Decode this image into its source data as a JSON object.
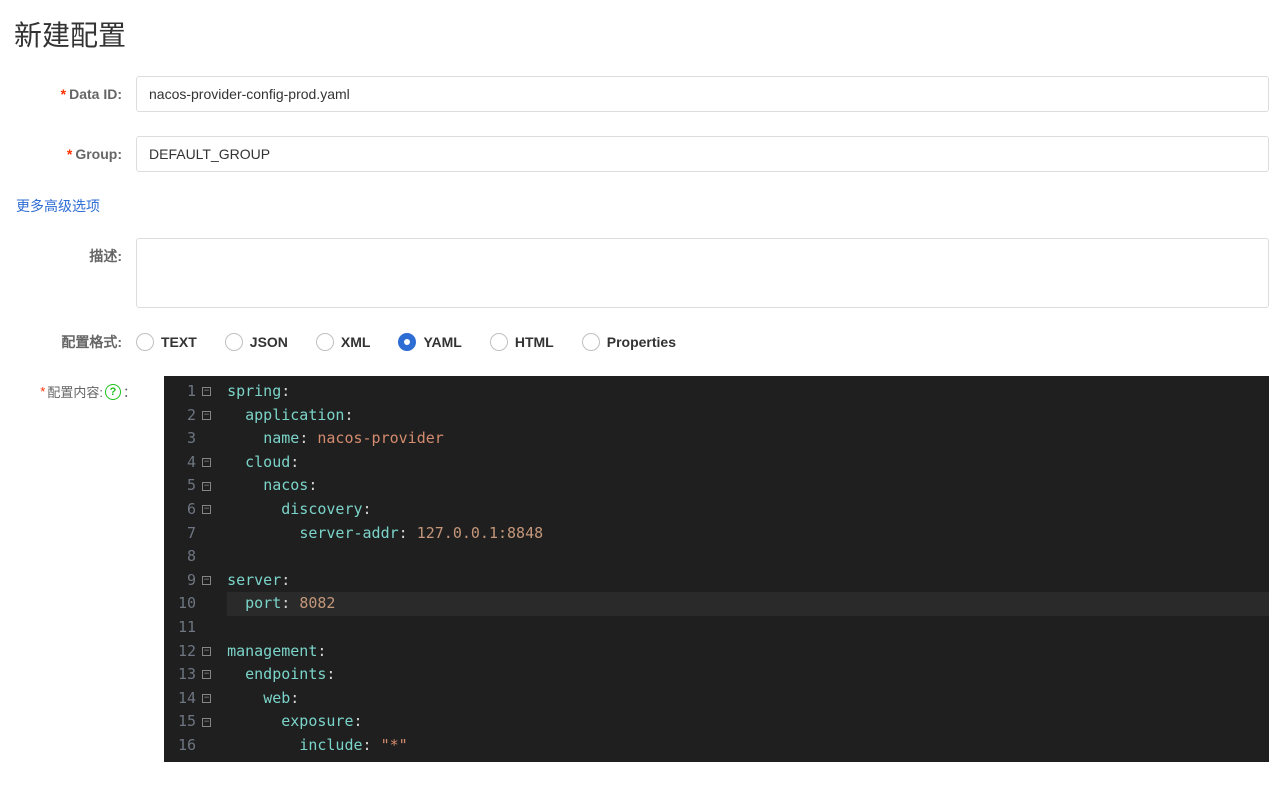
{
  "title": "新建配置",
  "labels": {
    "dataId": "Data ID:",
    "group": "Group:",
    "desc": "描述:",
    "format": "配置格式:",
    "content": "配置内容:"
  },
  "values": {
    "dataId": "nacos-provider-config-prod.yaml",
    "group": "DEFAULT_GROUP",
    "desc": ""
  },
  "advLink": "更多高级选项",
  "formatOptions": [
    "TEXT",
    "JSON",
    "XML",
    "YAML",
    "HTML",
    "Properties"
  ],
  "formatSelected": "YAML",
  "editor": {
    "lines": [
      {
        "num": 1,
        "fold": true,
        "tokens": [
          {
            "t": "spring",
            "c": "k-key"
          },
          {
            "t": ":",
            "c": "k-punc"
          }
        ]
      },
      {
        "num": 2,
        "fold": true,
        "tokens": [
          {
            "t": "  ",
            "c": ""
          },
          {
            "t": "application",
            "c": "k-key"
          },
          {
            "t": ":",
            "c": "k-punc"
          }
        ]
      },
      {
        "num": 3,
        "fold": false,
        "tokens": [
          {
            "t": "    ",
            "c": ""
          },
          {
            "t": "name",
            "c": "k-key"
          },
          {
            "t": ": ",
            "c": "k-punc"
          },
          {
            "t": "nacos-provider",
            "c": "k-str"
          }
        ]
      },
      {
        "num": 4,
        "fold": true,
        "tokens": [
          {
            "t": "  ",
            "c": ""
          },
          {
            "t": "cloud",
            "c": "k-key"
          },
          {
            "t": ":",
            "c": "k-punc"
          }
        ]
      },
      {
        "num": 5,
        "fold": true,
        "tokens": [
          {
            "t": "    ",
            "c": ""
          },
          {
            "t": "nacos",
            "c": "k-key"
          },
          {
            "t": ":",
            "c": "k-punc"
          }
        ]
      },
      {
        "num": 6,
        "fold": true,
        "tokens": [
          {
            "t": "      ",
            "c": ""
          },
          {
            "t": "discovery",
            "c": "k-key"
          },
          {
            "t": ":",
            "c": "k-punc"
          }
        ]
      },
      {
        "num": 7,
        "fold": false,
        "tokens": [
          {
            "t": "        ",
            "c": ""
          },
          {
            "t": "server-addr",
            "c": "k-key"
          },
          {
            "t": ": ",
            "c": "k-punc"
          },
          {
            "t": "127.0.0.1:8848",
            "c": "k-num"
          }
        ]
      },
      {
        "num": 8,
        "fold": false,
        "tokens": []
      },
      {
        "num": 9,
        "fold": true,
        "tokens": [
          {
            "t": "server",
            "c": "k-key"
          },
          {
            "t": ":",
            "c": "k-punc"
          }
        ]
      },
      {
        "num": 10,
        "fold": false,
        "hl": true,
        "tokens": [
          {
            "t": "  ",
            "c": ""
          },
          {
            "t": "port",
            "c": "k-key"
          },
          {
            "t": ": ",
            "c": "k-punc"
          },
          {
            "t": "8082",
            "c": "k-num"
          }
        ]
      },
      {
        "num": 11,
        "fold": false,
        "tokens": []
      },
      {
        "num": 12,
        "fold": true,
        "tokens": [
          {
            "t": "management",
            "c": "k-key"
          },
          {
            "t": ":",
            "c": "k-punc"
          }
        ]
      },
      {
        "num": 13,
        "fold": true,
        "tokens": [
          {
            "t": "  ",
            "c": ""
          },
          {
            "t": "endpoints",
            "c": "k-key"
          },
          {
            "t": ":",
            "c": "k-punc"
          }
        ]
      },
      {
        "num": 14,
        "fold": true,
        "tokens": [
          {
            "t": "    ",
            "c": ""
          },
          {
            "t": "web",
            "c": "k-key"
          },
          {
            "t": ":",
            "c": "k-punc"
          }
        ]
      },
      {
        "num": 15,
        "fold": true,
        "tokens": [
          {
            "t": "      ",
            "c": ""
          },
          {
            "t": "exposure",
            "c": "k-key"
          },
          {
            "t": ":",
            "c": "k-punc"
          }
        ]
      },
      {
        "num": 16,
        "fold": false,
        "tokens": [
          {
            "t": "        ",
            "c": ""
          },
          {
            "t": "include",
            "c": "k-key"
          },
          {
            "t": ": ",
            "c": "k-punc"
          },
          {
            "t": "\"*\"",
            "c": "k-str"
          }
        ]
      }
    ]
  }
}
